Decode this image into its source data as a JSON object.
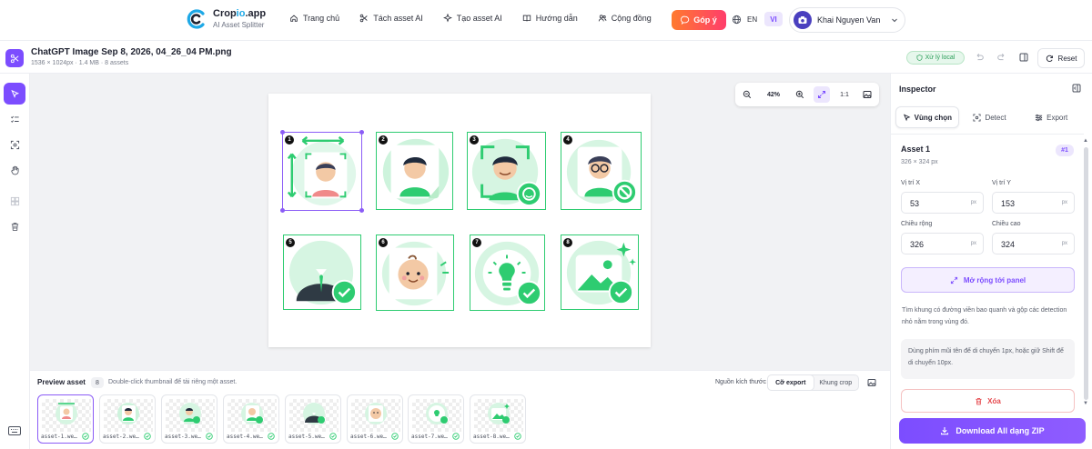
{
  "brand": {
    "name_prefix": "Crop",
    "name_highlight": "io",
    "name_suffix": ".app",
    "subtitle": "AI Asset Splitter"
  },
  "nav": {
    "items": [
      {
        "label": "Trang chủ",
        "icon": "home-icon"
      },
      {
        "label": "Tách asset AI",
        "icon": "scissors-icon"
      },
      {
        "label": "Tạo asset AI",
        "icon": "sparkle-icon"
      },
      {
        "label": "Hướng dẫn",
        "icon": "book-icon"
      },
      {
        "label": "Cộng đồng",
        "icon": "users-icon"
      }
    ]
  },
  "header": {
    "feedback_label": "Góp ý",
    "lang_en": "EN",
    "lang_vi": "VI",
    "user_name": "Khai Nguyen Van"
  },
  "file": {
    "name": "ChatGPT Image Sep 8, 2026, 04_26_04 PM.png",
    "meta": "1536 × 1024px · 1.4 MB · 8 assets",
    "local_badge": "Xử lý local",
    "reset_label": "Reset"
  },
  "zoom": {
    "value": "42%",
    "one_to_one": "1:1"
  },
  "canvas": {
    "assets": [
      {
        "num": "1",
        "kind": "resize",
        "selected": true
      },
      {
        "num": "2",
        "kind": "sticker"
      },
      {
        "num": "3",
        "kind": "face-scan"
      },
      {
        "num": "4",
        "kind": "blocked"
      },
      {
        "num": "5",
        "kind": "suit"
      },
      {
        "num": "6",
        "kind": "baby"
      },
      {
        "num": "7",
        "kind": "idea"
      },
      {
        "num": "8",
        "kind": "image"
      }
    ]
  },
  "preview": {
    "title": "Preview asset",
    "count": "8",
    "hint": "Double-click thumbnail để tải riêng một asset.",
    "source_label": "Nguồn kích thước",
    "seg_export": "Cỡ export",
    "seg_crop": "Khung crop",
    "thumbs": [
      {
        "name": "asset-1.we…"
      },
      {
        "name": "asset-2.we…"
      },
      {
        "name": "asset-3.we…"
      },
      {
        "name": "asset-4.we…"
      },
      {
        "name": "asset-5.we…"
      },
      {
        "name": "asset-6.we…"
      },
      {
        "name": "asset-7.we…"
      },
      {
        "name": "asset-8.we…"
      }
    ]
  },
  "inspector": {
    "title": "Inspector",
    "tabs": [
      {
        "label": "Vùng chọn"
      },
      {
        "label": "Detect"
      },
      {
        "label": "Export"
      }
    ],
    "asset_title": "Asset 1",
    "asset_badge": "#1",
    "asset_dim": "326 × 324 px",
    "fields": {
      "x_label": "Vị trí X",
      "x_value": "53",
      "y_label": "Vị trí Y",
      "y_value": "153",
      "w_label": "Chiều rộng",
      "w_value": "326",
      "h_label": "Chiều cao",
      "h_value": "324",
      "unit": "px"
    },
    "expand_label": "Mở rộng tới panel",
    "description": "Tìm khung có đường viền bao quanh và gộp các detection nhỏ nằm trong vùng đó.",
    "tip": "Dùng phím mũi tên để di chuyển 1px, hoặc giữ Shift để di chuyển 10px.",
    "delete_label": "Xóa",
    "download_label": "Download All dạng ZIP"
  },
  "colors": {
    "accent": "#7c4dff",
    "success": "#2ecc71",
    "danger": "#e5484d",
    "feedback": "#ff5a4d"
  }
}
